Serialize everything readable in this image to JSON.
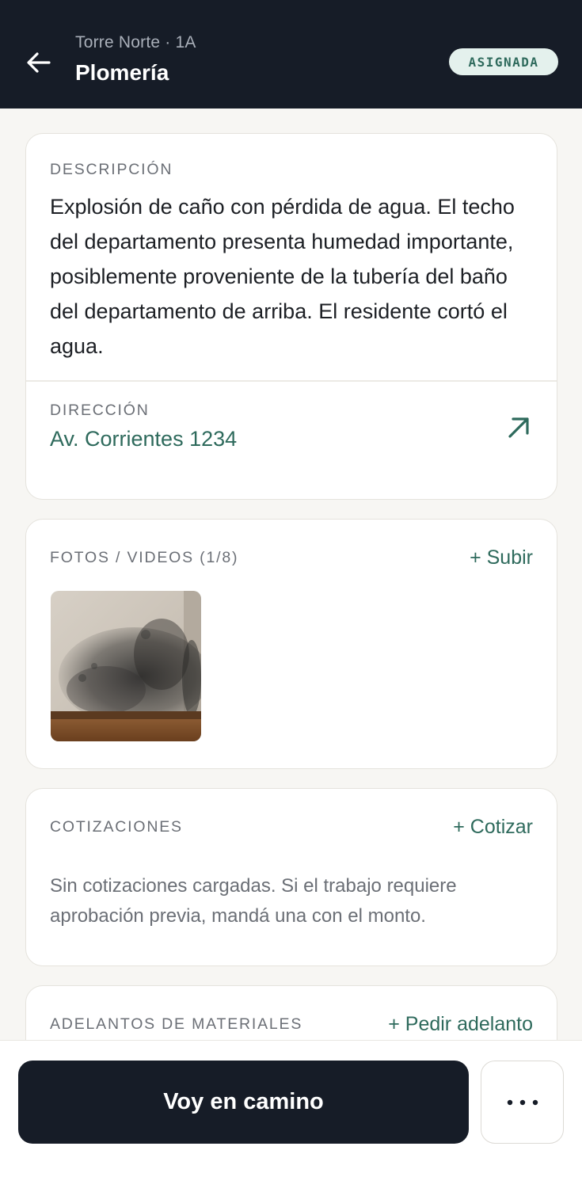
{
  "header": {
    "subtitle": "Torre Norte · 1A",
    "title": "Plomería",
    "status_badge": "ASIGNADA",
    "back_icon": "arrow-left-icon"
  },
  "description_card": {
    "label": "DESCRIPCIÓN",
    "text": "Explosión de caño con pérdida de agua. El techo del departamento presenta humedad importante, posiblemente proveniente de la tubería del baño del departamento de arriba. El residente cortó el agua.",
    "address_label": "DIRECCIÓN",
    "address": "Av. Corrientes 1234",
    "address_icon": "external-arrow-icon"
  },
  "media_card": {
    "label": "FOTOS / VIDEOS (1/8)",
    "action": "+ Subir",
    "thumbnails": [
      {
        "icon": "mold-wall-photo"
      }
    ]
  },
  "quotes_card": {
    "label": "COTIZACIONES",
    "action": "+ Cotizar",
    "empty_text": "Sin cotizaciones cargadas. Si el trabajo requiere aprobación previa, mandá una con el monto."
  },
  "advances_card": {
    "label": "ADELANTOS DE MATERIALES",
    "action": "+ Pedir adelanto"
  },
  "bottom_bar": {
    "primary_button": "Voy en camino",
    "more_icon": "more-horizontal-icon"
  },
  "colors": {
    "header_bg": "#161c27",
    "accent": "#2e6a5c",
    "badge_bg": "#e4f1ed",
    "page_bg": "#f7f6f3"
  }
}
